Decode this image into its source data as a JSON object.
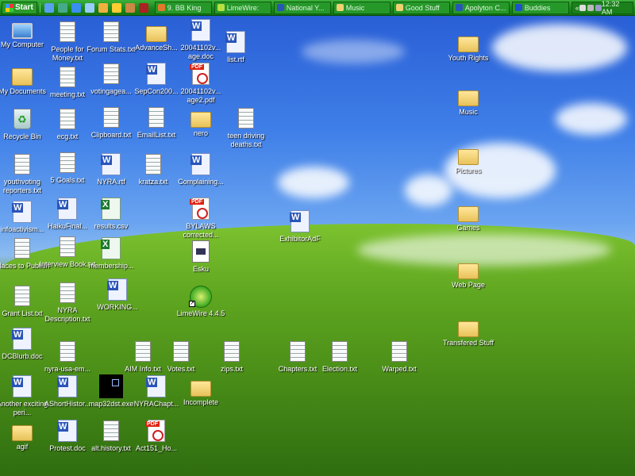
{
  "taskbar": {
    "start_label": "Start",
    "quick_launch": [
      "show-desktop-icon",
      "msn-icon",
      "internet-explorer-icon",
      "network-icon",
      "outlook-icon",
      "aim-icon",
      "media-icon",
      "game-icon"
    ],
    "tasks": [
      {
        "label": "9. BB King",
        "icon": "winamp-icon",
        "color": "#e07a2a"
      },
      {
        "label": "LimeWire:",
        "icon": "limewire-icon",
        "color": "#b8e040"
      },
      {
        "label": "National Y...",
        "icon": "word-icon",
        "color": "#2a55b8"
      },
      {
        "label": "Music",
        "icon": "folder-icon",
        "color": "#f0d070"
      },
      {
        "label": "Good Stuff",
        "icon": "folder-icon",
        "color": "#f0d070"
      },
      {
        "label": "Apolyton C...",
        "icon": "word-icon",
        "color": "#2a55b8"
      },
      {
        "label": "Buddies",
        "icon": "buddy-list-icon",
        "color": "#2050d0"
      }
    ],
    "tray": {
      "expand": "«",
      "clock": "12:32 AM"
    }
  },
  "desktop": {
    "icons": [
      {
        "label": "My Computer",
        "type": "computer"
      },
      {
        "label": "My Documents",
        "type": "mydocs"
      },
      {
        "label": "Recycle Bin",
        "type": "recycle"
      },
      {
        "label": "youthvoting reporters.txt",
        "type": "txt"
      },
      {
        "label": "infoactivism...",
        "type": "doc"
      },
      {
        "label": "Places to Publish",
        "type": "txt"
      },
      {
        "label": "Grant List.txt",
        "type": "txt"
      },
      {
        "label": "DCBlurb.doc",
        "type": "doc"
      },
      {
        "label": "Another exciting peri...",
        "type": "doc"
      },
      {
        "label": "agif",
        "type": "folder"
      },
      {
        "label": "People for Money.txt",
        "type": "txt"
      },
      {
        "label": "meeting.txt",
        "type": "txt"
      },
      {
        "label": "ecg.txt",
        "type": "txt"
      },
      {
        "label": "5 Goals.txt",
        "type": "txt"
      },
      {
        "label": "HaikuFinal...",
        "type": "doc"
      },
      {
        "label": "Interview Book.txt",
        "type": "txt"
      },
      {
        "label": "NYRA Description.txt",
        "type": "txt"
      },
      {
        "label": "nyra-usa-em...",
        "type": "txt"
      },
      {
        "label": "AShortHistor...",
        "type": "doc"
      },
      {
        "label": "Protest.doc",
        "type": "doc"
      },
      {
        "label": "Forum Stats.txt",
        "type": "txt"
      },
      {
        "label": "votingagea...",
        "type": "txt"
      },
      {
        "label": "Clipboard.txt",
        "type": "txt"
      },
      {
        "label": "NYRA.rtf",
        "type": "doc"
      },
      {
        "label": "results.csv",
        "type": "xls"
      },
      {
        "label": "membership...",
        "type": "xls"
      },
      {
        "label": "WORKING...",
        "type": "doc"
      },
      {
        "label": "AIM Info.txt",
        "type": "txt"
      },
      {
        "label": "map32dst.exe",
        "type": "exe"
      },
      {
        "label": "alt.history.txt",
        "type": "txt"
      },
      {
        "label": "AdvanceSh...",
        "type": "folder"
      },
      {
        "label": "SepCon200...",
        "type": "doc"
      },
      {
        "label": "EmailList.txt",
        "type": "txt"
      },
      {
        "label": "kratza.txt",
        "type": "txt"
      },
      {
        "label": "Votes.txt",
        "type": "txt"
      },
      {
        "label": "NYRAChapt...",
        "type": "doc"
      },
      {
        "label": "Act151_Ho...",
        "type": "pdf"
      },
      {
        "label": "20041102v... age.doc",
        "type": "doc"
      },
      {
        "label": "20041102v... age2.pdf",
        "type": "pdf"
      },
      {
        "label": "nero",
        "type": "folder"
      },
      {
        "label": "Complaining...",
        "type": "doc"
      },
      {
        "label": "BYLAWS corrected...",
        "type": "pdf"
      },
      {
        "label": "Esku",
        "type": "esku"
      },
      {
        "label": "LimeWire 4.4.5",
        "type": "limewire",
        "shortcut": true
      },
      {
        "label": "Incomplete",
        "type": "folder"
      },
      {
        "label": "list.rtf",
        "type": "doc"
      },
      {
        "label": "teen driving deaths.txt",
        "type": "txt"
      },
      {
        "label": "zips.txt",
        "type": "txt"
      },
      {
        "label": "ExhibitorAdF",
        "type": "doc"
      },
      {
        "label": "Chapters.txt",
        "type": "txt"
      },
      {
        "label": "Election.txt",
        "type": "txt"
      },
      {
        "label": "Warped.txt",
        "type": "txt"
      },
      {
        "label": "Youth Rights",
        "type": "folder"
      },
      {
        "label": "Music",
        "type": "folder"
      },
      {
        "label": "Pictures",
        "type": "folder"
      },
      {
        "label": "Games",
        "type": "folder"
      },
      {
        "label": "Web Page",
        "type": "folder"
      },
      {
        "label": "Transfered Stuff",
        "type": "folder"
      }
    ]
  }
}
